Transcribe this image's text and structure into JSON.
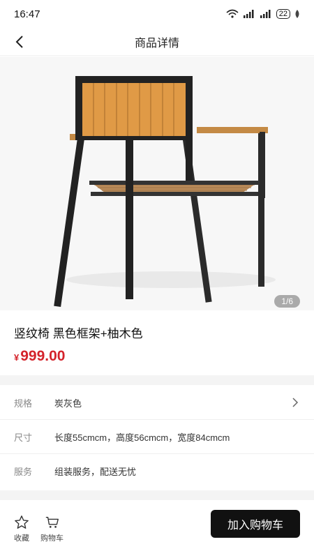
{
  "status_bar": {
    "time": "16:47",
    "battery": "22",
    "icons": [
      "wifi-icon",
      "signal-icon",
      "signal-icon",
      "battery-icon"
    ]
  },
  "nav": {
    "title": "商品详情",
    "back_icon": "chevron-left-icon"
  },
  "gallery": {
    "pager": "1/6"
  },
  "product": {
    "title": "竖纹椅 黑色框架+柚木色",
    "currency": "¥",
    "price": "999.00",
    "price_color": "#d4232b"
  },
  "specs": [
    {
      "label": "规格",
      "value": "炭灰色",
      "icon": "chevron-right-icon"
    },
    {
      "label": "尺寸",
      "value": "长度55cmcm，高度56cmcm，宽度84cmcm"
    },
    {
      "label": "服务",
      "value": "组装服务，配送无忧"
    }
  ],
  "bottom_bar": {
    "favorite_label": "收藏",
    "cart_label": "购物车",
    "add_to_cart_label": "加入购物车",
    "button_color": "#111111"
  }
}
